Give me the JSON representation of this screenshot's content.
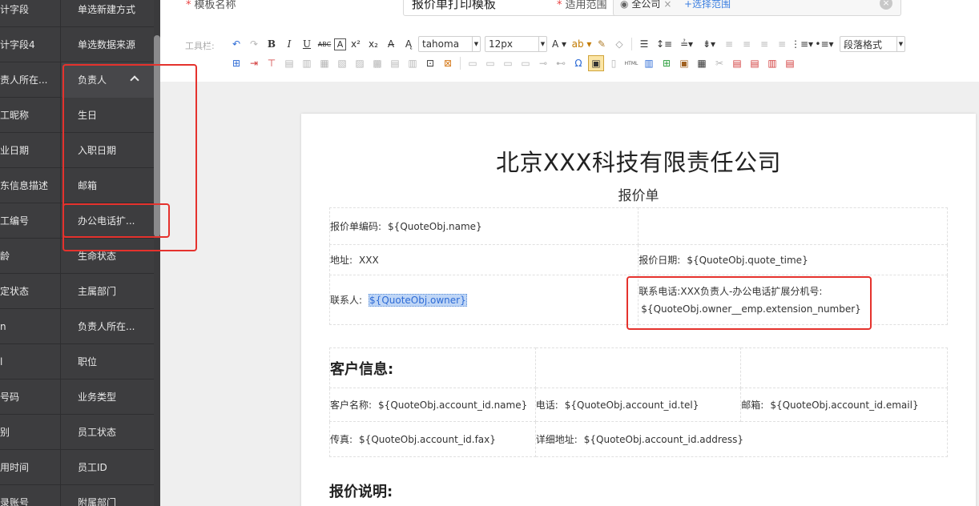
{
  "sidebar": {
    "rows": [
      {
        "left": "计字段",
        "right": "单选新建方式",
        "top": 0
      },
      {
        "left": "计字段4",
        "right": "单选数据来源",
        "top": 0
      },
      {
        "left": "责人所在...",
        "right": "负责人",
        "top": 0
      },
      {
        "left": "工昵称",
        "right": "生日",
        "top": 0
      },
      {
        "left": "业日期",
        "right": "入职日期",
        "top": 0
      },
      {
        "left": "东信息描述",
        "right": "邮箱",
        "top": 0
      },
      {
        "left": "工编号",
        "right": "办公电话扩...",
        "top": 0
      },
      {
        "left": "龄",
        "right": "生命状态",
        "top": 0
      },
      {
        "left": "定状态",
        "right": "主属部门",
        "top": 0
      },
      {
        "left": "n",
        "right": "负责人所在...",
        "top": 0
      },
      {
        "left": "l",
        "right": "职位",
        "top": 0
      },
      {
        "left": "号码",
        "right": "业务类型",
        "top": 0
      },
      {
        "left": "别",
        "right": "员工状态",
        "top": 0
      },
      {
        "left": "用时间",
        "right": "员工ID",
        "top": 0
      },
      {
        "left": "录账号",
        "right": "附属部门",
        "top": 0
      }
    ]
  },
  "header": {
    "template_name_label": "模板名称",
    "template_name_value": "报价单打印模板",
    "scope_label": "适用范围",
    "scope_tag": "全公司",
    "scope_tag_remove": "×",
    "scope_add": "+选择范围",
    "scope_clear": "×"
  },
  "toolbar": {
    "label": "工具栏:",
    "font_family": "tahoma",
    "font_size": "12px",
    "paragraph_format": "段落格式"
  },
  "document": {
    "company": "北京XXX科技有限责任公司",
    "title": "报价单",
    "quote_no_label": "报价单编码:",
    "quote_no_value": "${QuoteObj.name}",
    "address_label": "地址:",
    "address_value": "XXX",
    "quote_date_label": "报价日期:",
    "quote_date_value": "${QuoteObj.quote_time}",
    "contact_label": "联系人:",
    "contact_value": "${QuoteObj.owner}",
    "phone_label": "联系电话:",
    "phone_desc": "XXX负责人-办公电话扩展分机号:",
    "phone_value": "${QuoteObj.owner__emp.extension_number}",
    "customer_section": "客户信息:",
    "cust_name_label": "客户名称:",
    "cust_name_value": "${QuoteObj.account_id.name}",
    "tel_label": "电话:",
    "tel_value": "${QuoteObj.account_id.tel}",
    "email_label": "邮箱:",
    "email_value": "${QuoteObj.account_id.email}",
    "fax_label": "传真:",
    "fax_value": "${QuoteObj.account_id.fax}",
    "detail_addr_label": "详细地址:",
    "detail_addr_value": "${QuoteObj.account_id.address}",
    "quote_notes_section": "报价说明:"
  },
  "colors": {
    "sidebar_bg": "#3d3d3f",
    "annotation_red": "#e5322d",
    "link_blue": "#3a7ee0",
    "selection_bg": "#bfd6f6"
  }
}
